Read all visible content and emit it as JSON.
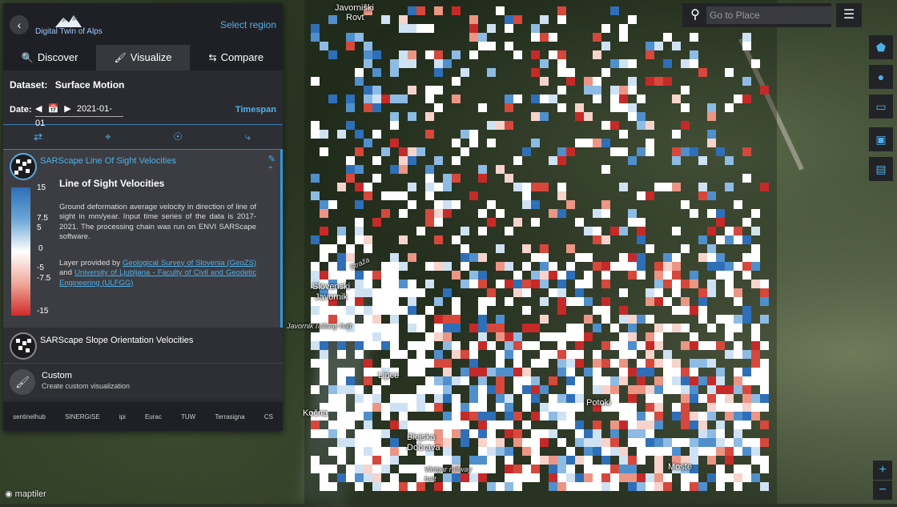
{
  "header": {
    "logo_text": "Digital Twin of Alps",
    "select_region": "Select region",
    "back_icon": "arrow-left-icon"
  },
  "tabs": [
    {
      "label": "Discover",
      "icon": "search-icon"
    },
    {
      "label": "Visualize",
      "icon": "brush-icon"
    },
    {
      "label": "Compare",
      "icon": "arrows-icon"
    }
  ],
  "dataset": {
    "label": "Dataset:",
    "value": "Surface Motion"
  },
  "date": {
    "label": "Date:",
    "value": "2021-01-01",
    "timespan": "Timespan"
  },
  "layers": [
    {
      "title": "SARScape Line Of Sight Velocities",
      "legend_title": "Line of Sight Velocities",
      "legend_ticks": [
        "15",
        "7.5",
        "5",
        "0",
        "-5",
        "-7.5",
        "-15"
      ],
      "description": "Ground deformation average velocity in direction of line of sight in mm/year. Input time series of the data is 2017-2021. The processing chain was run on ENVI SARScape software.",
      "provider_prefix": "Layer provided by",
      "provider_1": "Geological Survey of Slovenia (GeoZS)",
      "provider_and": "and",
      "provider_2": "University of Ljubljana - Faculty of Civil and Geodetic Engineering (ULFGG)"
    },
    {
      "title": "SARScape Slope Orientation Velocities"
    }
  ],
  "custom": {
    "title": "Custom",
    "subtitle": "Create custom visualization"
  },
  "footer_logos": [
    "sentinelhub",
    "SINERGISE",
    "ipi",
    "Eurac",
    "TUW",
    "Terrasigna",
    "CS"
  ],
  "search": {
    "placeholder": "Go to Place"
  },
  "map_labels": [
    {
      "text": "Javorniški"
    },
    {
      "text": "Rovt"
    },
    {
      "text": "Slovenski"
    },
    {
      "text": "Javornik"
    },
    {
      "text": "Lipce"
    },
    {
      "text": "Potoki"
    },
    {
      "text": "Kočna"
    },
    {
      "text": "Blejska"
    },
    {
      "text": "Dobrava"
    },
    {
      "text": "Moste"
    },
    {
      "text": "Straža"
    },
    {
      "text": "Javornik railway halt"
    },
    {
      "text": "Vintgar railway halt"
    }
  ],
  "attribution": "maptiler",
  "zoom": {
    "in": "+",
    "out": "−"
  },
  "colors": {
    "accent": "#4fb0e8",
    "panel": "#2a2b30",
    "high": "#2e6fb8",
    "low": "#d02a28"
  }
}
